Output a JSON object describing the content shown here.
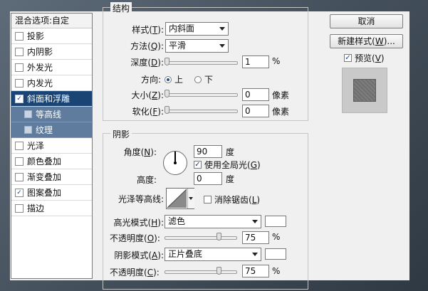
{
  "style_list": {
    "header": "混合选项:自定",
    "items": [
      {
        "label": "投影",
        "checked": false
      },
      {
        "label": "内阴影",
        "checked": false
      },
      {
        "label": "外发光",
        "checked": false
      },
      {
        "label": "内发光",
        "checked": false
      },
      {
        "label": "斜面和浮雕",
        "checked": true,
        "selected": true
      },
      {
        "label": "等高线",
        "checked": false,
        "sub": true
      },
      {
        "label": "纹理",
        "checked": false,
        "sub": true
      },
      {
        "label": "光泽",
        "checked": false
      },
      {
        "label": "颜色叠加",
        "checked": false
      },
      {
        "label": "渐变叠加",
        "checked": false
      },
      {
        "label": "图案叠加",
        "checked": true
      },
      {
        "label": "描边",
        "checked": false
      }
    ]
  },
  "structure": {
    "legend": "结构",
    "style_label": "样式(",
    "style_key": "T",
    "style_value": "内斜面",
    "method_label": "方法(",
    "method_key": "Q",
    "method_value": "平滑",
    "depth_label": "深度(",
    "depth_key": "D",
    "depth_value": "1",
    "depth_unit": "%",
    "direction_label": "方向:",
    "dir_up": "上",
    "dir_down": "下",
    "size_label": "大小(",
    "size_key": "Z",
    "size_value": "0",
    "size_unit": "像素",
    "soften_label": "软化(",
    "soften_key": "F",
    "soften_value": "0",
    "soften_unit": "像素"
  },
  "shading": {
    "legend": "阴影",
    "angle_label": "角度(",
    "angle_key": "N",
    "angle_value": "90",
    "angle_unit": "度",
    "global_light_label": "使用全局光(",
    "global_light_key": "G",
    "global_light_checked": true,
    "altitude_label": "高度:",
    "altitude_value": "0",
    "altitude_unit": "度",
    "gloss_label": "光泽等高线:",
    "antialias_label": "消除锯齿(",
    "antialias_key": "L",
    "antialias_checked": false,
    "highlight_mode_label": "高光模式(",
    "highlight_mode_key": "H",
    "highlight_mode_value": "滤色",
    "highlight_color": "#ffffff",
    "highlight_opacity_label": "不透明度(",
    "highlight_opacity_key": "O",
    "highlight_opacity_value": "75",
    "highlight_opacity_unit": "%",
    "shadow_mode_label": "阴影模式(",
    "shadow_mode_key": "A",
    "shadow_mode_value": "正片叠底",
    "shadow_color": "#ffffff",
    "shadow_opacity_label": "不透明度(",
    "shadow_opacity_key": "C",
    "shadow_opacity_value": "75",
    "shadow_opacity_unit": "%"
  },
  "buttons": {
    "cancel": "取消",
    "new_style_pre": "新建样式(",
    "new_style_key": "W",
    "new_style_post": ")...",
    "preview_label": "预览(",
    "preview_key": "V",
    "preview_checked": true
  }
}
